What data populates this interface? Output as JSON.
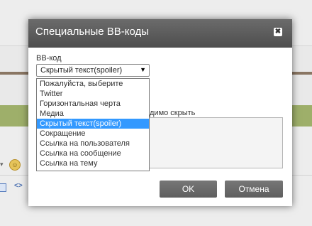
{
  "dialog": {
    "title": "Специальные BB-коды",
    "field_label": "BB-код",
    "selected_value": "Скрытый текст(spoiler)",
    "options": [
      "Пожалуйста, выберите",
      "Twitter",
      "Горизонтальная черта",
      "Медиа",
      "Скрытый текст(spoiler)",
      "Сокращение",
      "Ссылка на пользователя",
      "Ссылка на сообщение",
      "Ссылка на тему"
    ],
    "selected_index": 4,
    "partial_label": "димо скрыть",
    "ok_label": "OK",
    "cancel_label": "Отмена"
  }
}
